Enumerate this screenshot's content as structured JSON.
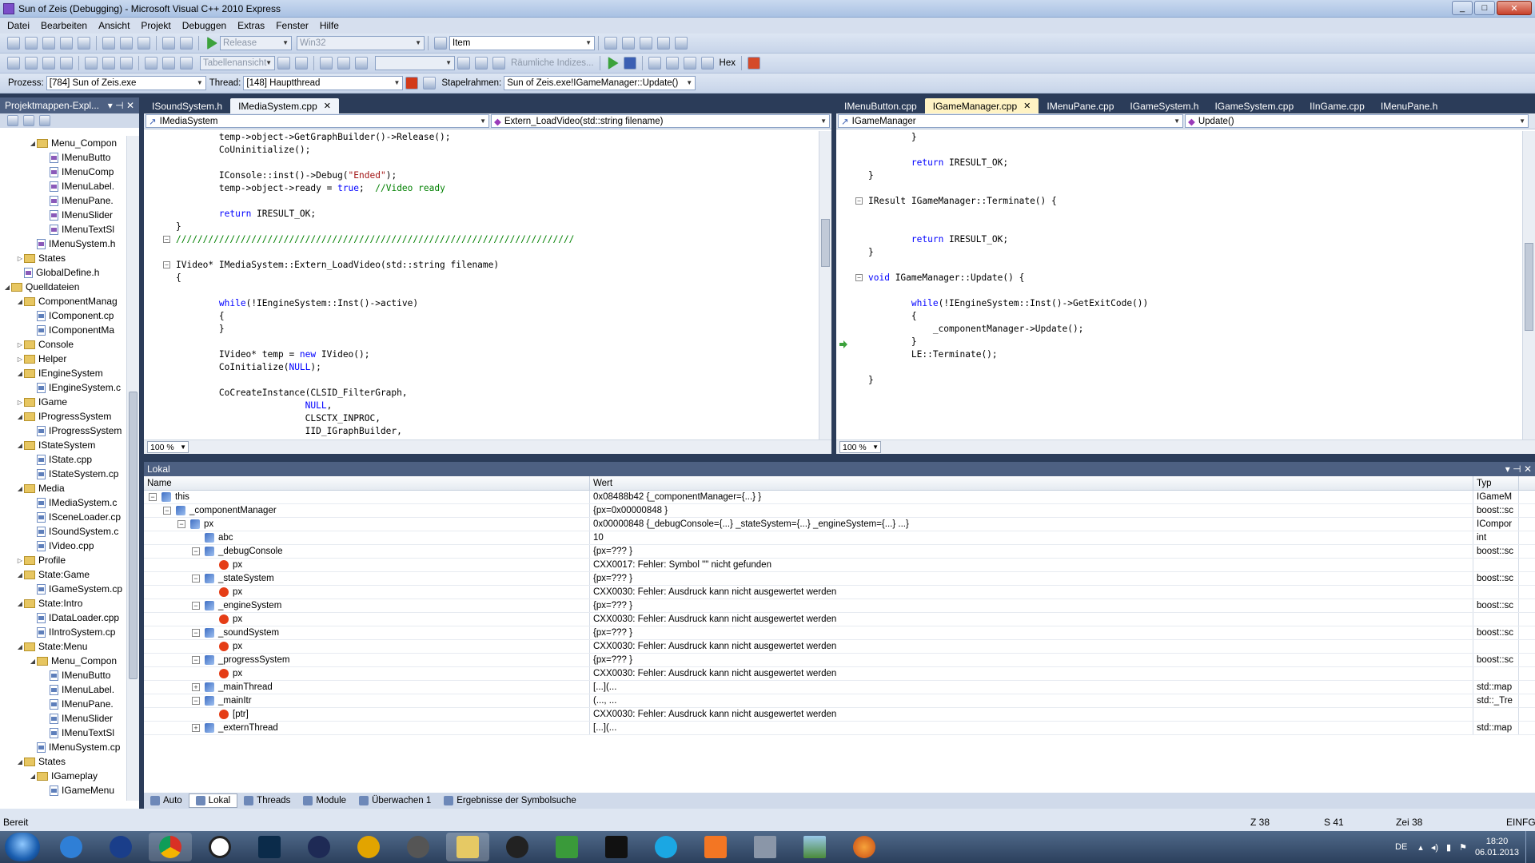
{
  "window": {
    "title": "Sun of Zeis (Debugging) - Microsoft Visual C++ 2010 Express"
  },
  "menu": [
    "Datei",
    "Bearbeiten",
    "Ansicht",
    "Projekt",
    "Debuggen",
    "Extras",
    "Fenster",
    "Hilfe"
  ],
  "toolbar1": {
    "config": "Release",
    "platform": "Win32",
    "find": "Item"
  },
  "toolbar2": {
    "table_view": "Tabellenansicht",
    "spatial": "Räumliche Indizes...",
    "hex": "Hex"
  },
  "toolbar3": {
    "process_label": "Prozess:",
    "process": "[784] Sun of Zeis.exe",
    "thread_label": "Thread:",
    "thread": "[148] Hauptthread",
    "stack_label": "Stapelrahmen:",
    "stack": "Sun of Zeis.exe!IGameManager::Update()"
  },
  "solution": {
    "title": "Projektmappen-Expl...",
    "tree": [
      {
        "d": 2,
        "t": "folder",
        "e": "◢",
        "n": "Menu_Compon"
      },
      {
        "d": 3,
        "t": "h",
        "n": "IMenuButto"
      },
      {
        "d": 3,
        "t": "h",
        "n": "IMenuComp"
      },
      {
        "d": 3,
        "t": "h",
        "n": "IMenuLabel."
      },
      {
        "d": 3,
        "t": "h",
        "n": "IMenuPane."
      },
      {
        "d": 3,
        "t": "h",
        "n": "IMenuSlider"
      },
      {
        "d": 3,
        "t": "h",
        "n": "IMenuTextSl"
      },
      {
        "d": 2,
        "t": "h",
        "n": "IMenuSystem.h"
      },
      {
        "d": 1,
        "t": "folder",
        "e": "▷",
        "n": "States"
      },
      {
        "d": 1,
        "t": "h",
        "n": "GlobalDefine.h"
      },
      {
        "d": 0,
        "t": "folder",
        "e": "◢",
        "n": "Quelldateien"
      },
      {
        "d": 1,
        "t": "folder",
        "e": "◢",
        "n": "ComponentManag"
      },
      {
        "d": 2,
        "t": "cpp",
        "n": "IComponent.cp"
      },
      {
        "d": 2,
        "t": "cpp",
        "n": "IComponentMa"
      },
      {
        "d": 1,
        "t": "folder",
        "e": "▷",
        "n": "Console"
      },
      {
        "d": 1,
        "t": "folder",
        "e": "▷",
        "n": "Helper"
      },
      {
        "d": 1,
        "t": "folder",
        "e": "◢",
        "n": "IEngineSystem"
      },
      {
        "d": 2,
        "t": "cpp",
        "n": "IEngineSystem.c"
      },
      {
        "d": 1,
        "t": "folder",
        "e": "▷",
        "n": "IGame"
      },
      {
        "d": 1,
        "t": "folder",
        "e": "◢",
        "n": "IProgressSystem"
      },
      {
        "d": 2,
        "t": "cpp",
        "n": "IProgressSystem"
      },
      {
        "d": 1,
        "t": "folder",
        "e": "◢",
        "n": "IStateSystem"
      },
      {
        "d": 2,
        "t": "cpp",
        "n": "IState.cpp"
      },
      {
        "d": 2,
        "t": "cpp",
        "n": "IStateSystem.cp"
      },
      {
        "d": 1,
        "t": "folder",
        "e": "◢",
        "n": "Media"
      },
      {
        "d": 2,
        "t": "cpp",
        "n": "IMediaSystem.c"
      },
      {
        "d": 2,
        "t": "cpp",
        "n": "ISceneLoader.cp"
      },
      {
        "d": 2,
        "t": "cpp",
        "n": "ISoundSystem.c"
      },
      {
        "d": 2,
        "t": "cpp",
        "n": "IVideo.cpp"
      },
      {
        "d": 1,
        "t": "folder",
        "e": "▷",
        "n": "Profile"
      },
      {
        "d": 1,
        "t": "folder",
        "e": "◢",
        "n": "State:Game"
      },
      {
        "d": 2,
        "t": "cpp",
        "n": "IGameSystem.cp"
      },
      {
        "d": 1,
        "t": "folder",
        "e": "◢",
        "n": "State:Intro"
      },
      {
        "d": 2,
        "t": "cpp",
        "n": "IDataLoader.cpp"
      },
      {
        "d": 2,
        "t": "cpp",
        "n": "IIntroSystem.cp"
      },
      {
        "d": 1,
        "t": "folder",
        "e": "◢",
        "n": "State:Menu"
      },
      {
        "d": 2,
        "t": "folder",
        "e": "◢",
        "n": "Menu_Compon"
      },
      {
        "d": 3,
        "t": "cpp",
        "n": "IMenuButto"
      },
      {
        "d": 3,
        "t": "cpp",
        "n": "IMenuLabel."
      },
      {
        "d": 3,
        "t": "cpp",
        "n": "IMenuPane."
      },
      {
        "d": 3,
        "t": "cpp",
        "n": "IMenuSlider"
      },
      {
        "d": 3,
        "t": "cpp",
        "n": "IMenuTextSl"
      },
      {
        "d": 2,
        "t": "cpp",
        "n": "IMenuSystem.cp"
      },
      {
        "d": 1,
        "t": "folder",
        "e": "◢",
        "n": "States"
      },
      {
        "d": 2,
        "t": "folder",
        "e": "◢",
        "n": "IGameplay"
      },
      {
        "d": 3,
        "t": "cpp",
        "n": "IGameMenu"
      }
    ]
  },
  "editor1": {
    "tabs": [
      "ISoundSystem.h",
      "IMediaSystem.cpp"
    ],
    "active": 1,
    "nav_left": "IMediaSystem",
    "nav_right": "Extern_LoadVideo(std::string filename)",
    "zoom": "100 %",
    "lines": [
      "        temp->object->GetGraphBuilder()->Release();",
      "        CoUninitialize();",
      "",
      "        IConsole::inst()->Debug(\"Ended\");",
      "        temp->object->ready = true;  //Video ready",
      "",
      "        return IRESULT_OK;",
      "}",
      "//////////////////////////////////////////////////////////////////////////",
      "",
      "IVideo* IMediaSystem::Extern_LoadVideo(std::string filename)",
      "{",
      "",
      "        while(!IEngineSystem::Inst()->active)",
      "        {",
      "        }",
      "",
      "        IVideo* temp = new IVideo();",
      "        CoInitialize(NULL);",
      "",
      "        CoCreateInstance(CLSID_FilterGraph,",
      "                        NULL,",
      "                        CLSCTX_INPROC,",
      "                        IID_IGraphBuilder,"
    ]
  },
  "editor2": {
    "tabs": [
      "IMenuButton.cpp",
      "IGameManager.cpp",
      "IMenuPane.cpp",
      "IGameSystem.h",
      "IGameSystem.cpp",
      "IInGame.cpp",
      "IMenuPane.h"
    ],
    "active": 1,
    "nav_left": "IGameManager",
    "nav_right": "Update()",
    "zoom": "100 %",
    "lines": [
      "        }",
      "",
      "        return IRESULT_OK;",
      "}",
      "",
      "IResult IGameManager::Terminate() {",
      "",
      "",
      "        return IRESULT_OK;",
      "}",
      "",
      "void IGameManager::Update() {",
      "",
      "        while(!IEngineSystem::Inst()->GetExitCode())",
      "        {",
      "            _componentManager->Update();",
      "        }",
      "        LE::Terminate();",
      "",
      "}"
    ]
  },
  "locals": {
    "title": "Lokal",
    "columns": [
      "Name",
      "Wert",
      "Typ"
    ],
    "rows": [
      {
        "d": 0,
        "x": "⊟",
        "i": "var",
        "n": "this",
        "v": "0x08488b42 {_componentManager={...} }",
        "t": "IGameM"
      },
      {
        "d": 1,
        "x": "⊟",
        "i": "var",
        "n": "_componentManager",
        "v": "{px=0x00000848 }",
        "t": "boost::sc"
      },
      {
        "d": 2,
        "x": "⊟",
        "i": "var",
        "n": "px",
        "v": "0x00000848 {_debugConsole={...} _stateSystem={...} _engineSystem={...} ...}",
        "t": "ICompor"
      },
      {
        "d": 3,
        "x": "",
        "i": "var",
        "n": "abc",
        "v": "10",
        "t": "int"
      },
      {
        "d": 3,
        "x": "⊟",
        "i": "var",
        "n": "_debugConsole",
        "v": "{px=??? }",
        "t": "boost::sc"
      },
      {
        "d": 4,
        "x": "",
        "i": "err",
        "n": "px",
        "v": "CXX0017: Fehler: Symbol \"\" nicht gefunden",
        "t": ""
      },
      {
        "d": 3,
        "x": "⊟",
        "i": "var",
        "n": "_stateSystem",
        "v": "{px=??? }",
        "t": "boost::sc"
      },
      {
        "d": 4,
        "x": "",
        "i": "err",
        "n": "px",
        "v": "CXX0030: Fehler: Ausdruck kann nicht ausgewertet werden",
        "t": ""
      },
      {
        "d": 3,
        "x": "⊟",
        "i": "var",
        "n": "_engineSystem",
        "v": "{px=??? }",
        "t": "boost::sc"
      },
      {
        "d": 4,
        "x": "",
        "i": "err",
        "n": "px",
        "v": "CXX0030: Fehler: Ausdruck kann nicht ausgewertet werden",
        "t": ""
      },
      {
        "d": 3,
        "x": "⊟",
        "i": "var",
        "n": "_soundSystem",
        "v": "{px=??? }",
        "t": "boost::sc"
      },
      {
        "d": 4,
        "x": "",
        "i": "err",
        "n": "px",
        "v": "CXX0030: Fehler: Ausdruck kann nicht ausgewertet werden",
        "t": ""
      },
      {
        "d": 3,
        "x": "⊟",
        "i": "var",
        "n": "_progressSystem",
        "v": "{px=??? }",
        "t": "boost::sc"
      },
      {
        "d": 4,
        "x": "",
        "i": "err",
        "n": "px",
        "v": "CXX0030: Fehler: Ausdruck kann nicht ausgewertet werden",
        "t": ""
      },
      {
        "d": 3,
        "x": "⊞",
        "i": "var",
        "n": "_mainThread",
        "v": "[...](...",
        "t": "std::map"
      },
      {
        "d": 3,
        "x": "⊟",
        "i": "var",
        "n": "_mainItr",
        "v": "(..., ...",
        "t": "std::_Tre"
      },
      {
        "d": 4,
        "x": "",
        "i": "err",
        "n": "[ptr]",
        "v": "CXX0030: Fehler: Ausdruck kann nicht ausgewertet werden",
        "t": ""
      },
      {
        "d": 3,
        "x": "⊞",
        "i": "var",
        "n": "_externThread",
        "v": "[...](...",
        "t": "std::map"
      }
    ]
  },
  "bottom_tabs": [
    "Auto",
    "Lokal",
    "Threads",
    "Module",
    "Überwachen 1",
    "Ergebnisse der Symbolsuche"
  ],
  "status": {
    "ready": "Bereit",
    "line": "Z 38",
    "col": "S 41",
    "char": "Zei 38",
    "mode": "EINFG"
  },
  "taskbar": {
    "lang": "DE",
    "time": "18:20",
    "date": "06.01.2013"
  }
}
